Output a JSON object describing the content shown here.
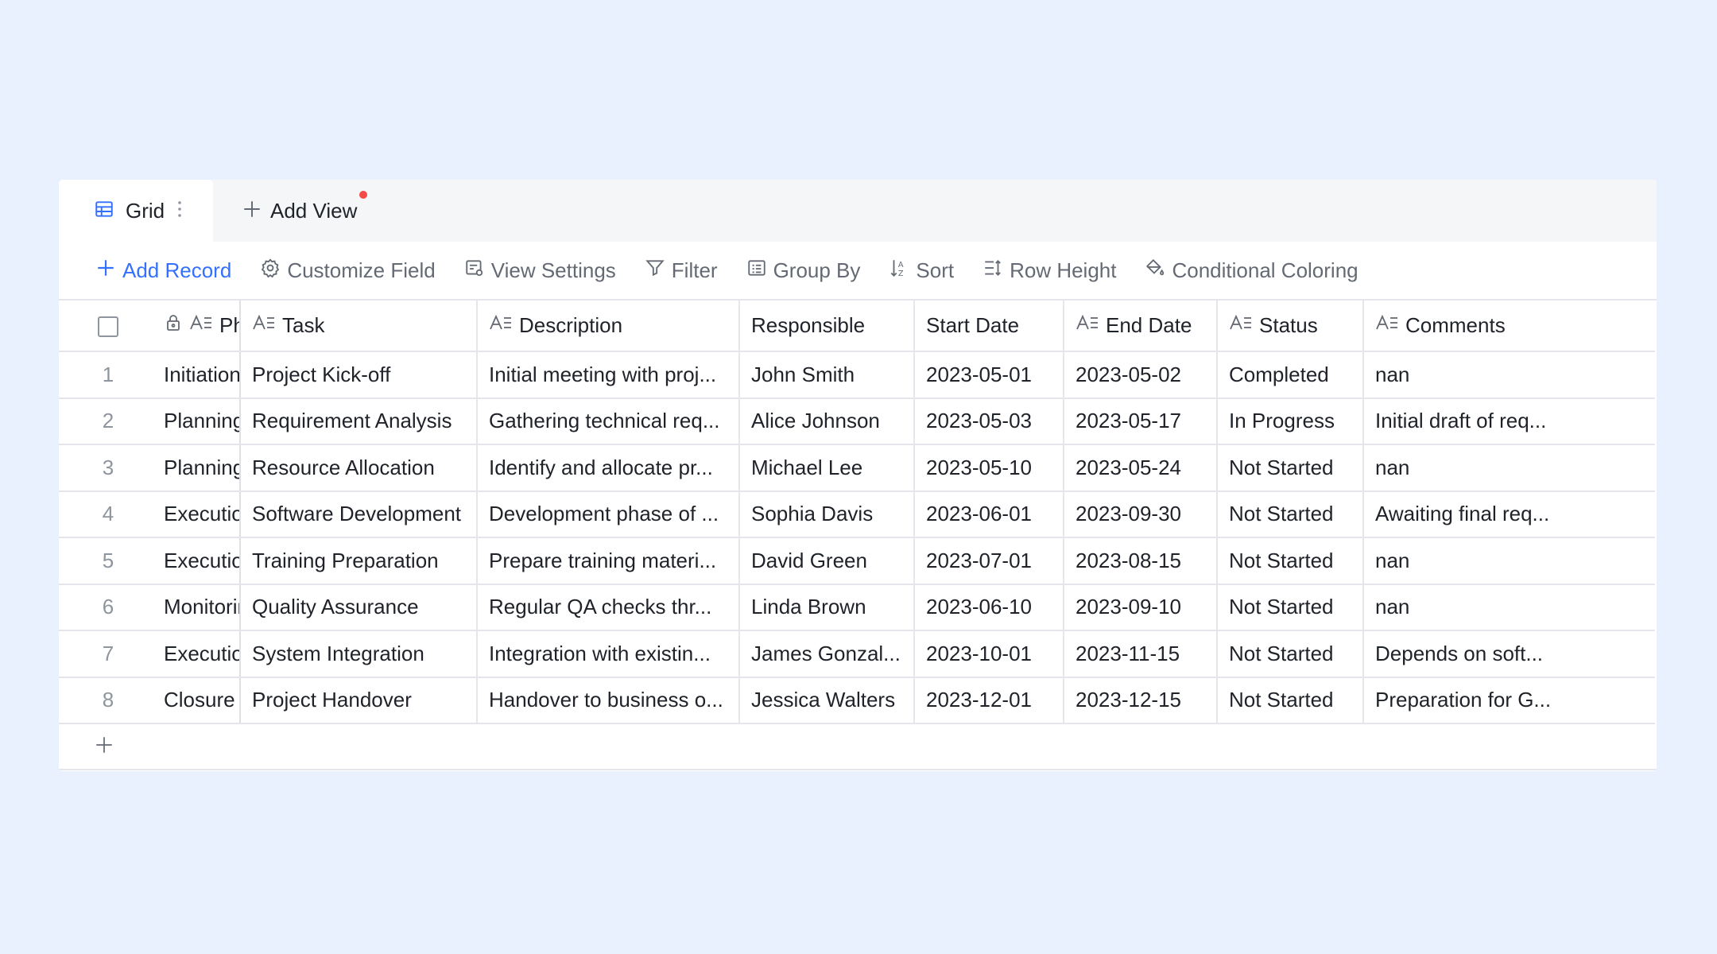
{
  "tabs": {
    "grid_label": "Grid",
    "add_view_label": "Add View"
  },
  "toolbar": {
    "add_record": "Add Record",
    "customize_field": "Customize Field",
    "view_settings": "View Settings",
    "filter": "Filter",
    "group_by": "Group By",
    "sort": "Sort",
    "row_height": "Row Height",
    "conditional_coloring": "Conditional Coloring"
  },
  "colors": {
    "accent": "#3370ff",
    "background": "#e9f0fe",
    "notification_dot": "#f54a45"
  },
  "table": {
    "columns": [
      "Phase",
      "Task",
      "Description",
      "Responsible",
      "Start Date",
      "End Date",
      "Status",
      "Comments"
    ],
    "rows": [
      {
        "num": "1",
        "cells": [
          "Initiation",
          "Project Kick-off",
          "Initial meeting with proj...",
          "John Smith",
          "2023-05-01",
          "2023-05-02",
          "Completed",
          "nan"
        ]
      },
      {
        "num": "2",
        "cells": [
          "Planning",
          "Requirement Analysis",
          "Gathering technical req...",
          "Alice Johnson",
          "2023-05-03",
          "2023-05-17",
          "In Progress",
          "Initial draft of req..."
        ]
      },
      {
        "num": "3",
        "cells": [
          "Planning",
          "Resource Allocation",
          "Identify and allocate pr...",
          "Michael Lee",
          "2023-05-10",
          "2023-05-24",
          "Not Started",
          "nan"
        ]
      },
      {
        "num": "4",
        "cells": [
          "Execution",
          "Software Development",
          "Development phase of ...",
          "Sophia Davis",
          "2023-06-01",
          "2023-09-30",
          "Not Started",
          "Awaiting final req..."
        ]
      },
      {
        "num": "5",
        "cells": [
          "Execution",
          "Training Preparation",
          "Prepare training materi...",
          "David Green",
          "2023-07-01",
          "2023-08-15",
          "Not Started",
          "nan"
        ]
      },
      {
        "num": "6",
        "cells": [
          "Monitoring",
          "Quality Assurance",
          "Regular QA checks thr...",
          "Linda Brown",
          "2023-06-10",
          "2023-09-10",
          "Not Started",
          "nan"
        ]
      },
      {
        "num": "7",
        "cells": [
          "Execution",
          "System Integration",
          "Integration with existin...",
          "James Gonzal...",
          "2023-10-01",
          "2023-11-15",
          "Not Started",
          "Depends on soft..."
        ]
      },
      {
        "num": "8",
        "cells": [
          "Closure",
          "Project Handover",
          "Handover to business o...",
          "Jessica Walters",
          "2023-12-01",
          "2023-12-15",
          "Not Started",
          "Preparation for G..."
        ]
      }
    ]
  }
}
